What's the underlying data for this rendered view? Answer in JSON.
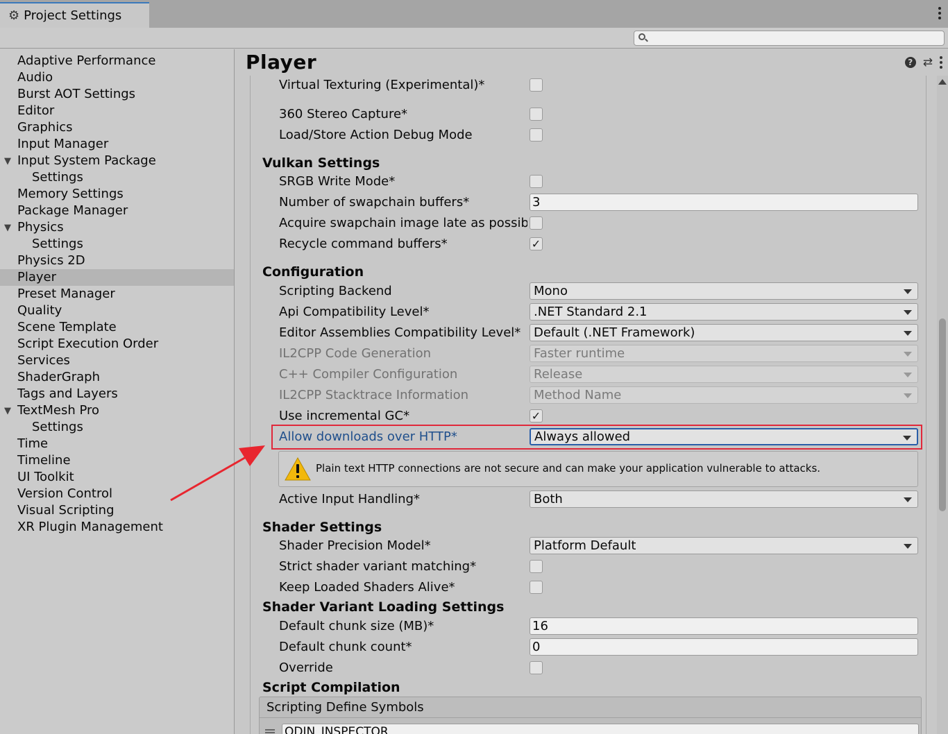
{
  "window": {
    "tab_title": "Project Settings"
  },
  "search": {
    "placeholder": ""
  },
  "sidebar": {
    "items": [
      {
        "label": "Adaptive Performance"
      },
      {
        "label": "Audio"
      },
      {
        "label": "Burst AOT Settings"
      },
      {
        "label": "Editor"
      },
      {
        "label": "Graphics"
      },
      {
        "label": "Input Manager"
      },
      {
        "label": "Input System Package",
        "expanded": true
      },
      {
        "label": "Settings",
        "child": true
      },
      {
        "label": "Memory Settings"
      },
      {
        "label": "Package Manager"
      },
      {
        "label": "Physics",
        "expanded": true
      },
      {
        "label": "Settings",
        "child": true
      },
      {
        "label": "Physics 2D"
      },
      {
        "label": "Player",
        "selected": true
      },
      {
        "label": "Preset Manager"
      },
      {
        "label": "Quality"
      },
      {
        "label": "Scene Template"
      },
      {
        "label": "Script Execution Order"
      },
      {
        "label": "Services"
      },
      {
        "label": "ShaderGraph"
      },
      {
        "label": "Tags and Layers"
      },
      {
        "label": "TextMesh Pro",
        "expanded": true
      },
      {
        "label": "Settings",
        "child": true
      },
      {
        "label": "Time"
      },
      {
        "label": "Timeline"
      },
      {
        "label": "UI Toolkit"
      },
      {
        "label": "Version Control"
      },
      {
        "label": "Visual Scripting"
      },
      {
        "label": "XR Plugin Management"
      }
    ]
  },
  "main": {
    "title": "Player",
    "rows": {
      "virtual_texturing": {
        "label": "Virtual Texturing (Experimental)*",
        "checked": false
      },
      "stereo_capture": {
        "label": "360 Stereo Capture*",
        "checked": false
      },
      "load_store_debug": {
        "label": "Load/Store Action Debug Mode",
        "checked": false
      },
      "vulkan_header": "Vulkan Settings",
      "srgb_write": {
        "label": "SRGB Write Mode*",
        "checked": false
      },
      "swapchain_buffers": {
        "label": "Number of swapchain buffers*",
        "value": "3"
      },
      "acquire_late": {
        "label": "Acquire swapchain image late as possible*",
        "checked": false
      },
      "recycle_buffers": {
        "label": "Recycle command buffers*",
        "checked": true
      },
      "config_header": "Configuration",
      "scripting_backend": {
        "label": "Scripting Backend",
        "value": "Mono"
      },
      "api_compat": {
        "label": "Api Compatibility Level*",
        "value": ".NET Standard 2.1"
      },
      "editor_asm_compat": {
        "label": "Editor Assemblies Compatibility Level*",
        "value": "Default (.NET Framework)"
      },
      "il2cpp_codegen": {
        "label": "IL2CPP Code Generation",
        "value": "Faster runtime"
      },
      "cpp_compiler": {
        "label": "C++ Compiler Configuration",
        "value": "Release"
      },
      "il2cpp_stacktrace": {
        "label": "IL2CPP Stacktrace Information",
        "value": "Method Name"
      },
      "incremental_gc": {
        "label": "Use incremental GC*",
        "checked": true
      },
      "allow_http": {
        "label": "Allow downloads over HTTP*",
        "value": "Always allowed"
      },
      "http_warning": "Plain text HTTP connections are not secure and can make your application vulnerable to attacks.",
      "active_input": {
        "label": "Active Input Handling*",
        "value": "Both"
      },
      "shader_header": "Shader Settings",
      "shader_precision": {
        "label": "Shader Precision Model*",
        "value": "Platform Default"
      },
      "strict_variant": {
        "label": "Strict shader variant matching*",
        "checked": false
      },
      "keep_shaders": {
        "label": "Keep Loaded Shaders Alive*",
        "checked": false
      },
      "variant_header": "Shader Variant Loading Settings",
      "chunk_size": {
        "label": "Default chunk size (MB)*",
        "value": "16"
      },
      "chunk_count": {
        "label": "Default chunk count*",
        "value": "0"
      },
      "override": {
        "label": "Override",
        "checked": false
      },
      "compilation_header": "Script Compilation",
      "define_symbols_header": "Scripting Define Symbols",
      "define_symbol_0": "ODIN_INSPECTOR"
    }
  },
  "colors": {
    "highlight_box": "#e0283a",
    "link_blue": "#1f4f8c",
    "arrow": "#e8262f"
  }
}
